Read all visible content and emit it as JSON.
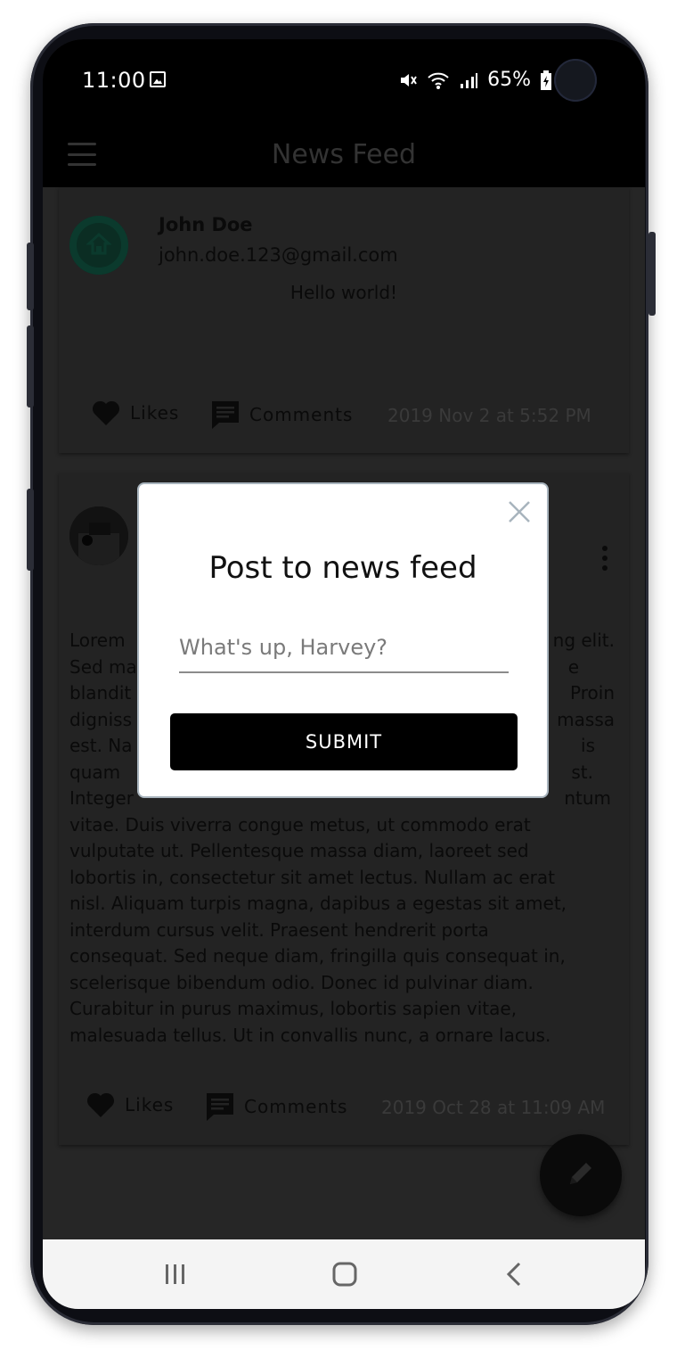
{
  "status_bar": {
    "time": "11:00",
    "battery": "65%",
    "icons": [
      "image-icon",
      "mute-icon",
      "wifi-icon",
      "signal-icon",
      "battery-icon"
    ]
  },
  "app_bar": {
    "title": "News Feed",
    "menu_icon": "hamburger-menu-icon"
  },
  "posts": [
    {
      "author": "John Doe",
      "email": "john.doe.123@gmail.com",
      "text": "Hello world!",
      "likes_label": "Likes",
      "comments_label": "Comments",
      "timestamp": "2019 Nov 2 at 5:52 PM"
    },
    {
      "text_lines": [
        "Lorem",
        "ng elit.",
        "Sed ma",
        "e",
        "blandit",
        "Proin",
        "digniss",
        "massa",
        "est. Na",
        "is",
        "quam",
        "st.",
        "Integer",
        "ntum",
        "vitae. Duis viverra congue metus, ut commodo erat",
        "vulputate ut. Pellentesque massa diam, laoreet sed",
        "lobortis in, consectetur sit amet lectus. Nullam ac erat",
        "nisl. Aliquam turpis magna, dapibus a egestas sit amet,",
        "interdum cursus velit. Praesent hendrerit porta",
        "consequat. Sed neque diam, fringilla quis consequat in,",
        "scelerisque bibendum odio. Donec id pulvinar diam.",
        "Curabitur in purus maximus, lobortis sapien vitae,",
        "malesuada tellus. Ut in convallis nunc, a ornare lacus."
      ],
      "likes_label": "Likes",
      "comments_label": "Comments",
      "timestamp": "2019 Oct 28 at 11:09 AM"
    }
  ],
  "dialog": {
    "title": "Post to news feed",
    "input_placeholder": "What's up, Harvey?",
    "input_value": "",
    "submit_label": "SUBMIT"
  },
  "colors": {
    "accent": "#000000",
    "avatar_ring": "#0b3a2d",
    "scrim": "#262626"
  }
}
